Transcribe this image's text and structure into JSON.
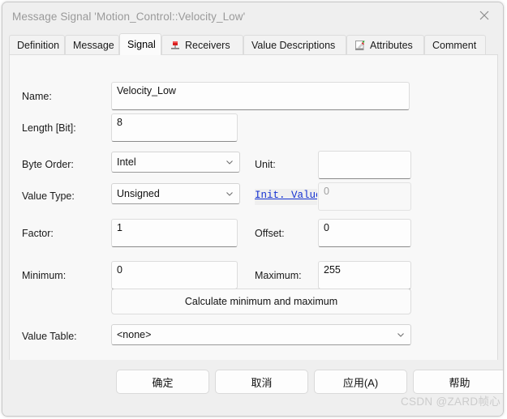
{
  "window": {
    "title": "Message Signal 'Motion_Control::Velocity_Low'",
    "close_icon": "close-icon"
  },
  "tabs": [
    {
      "label": "Definition",
      "icon": "",
      "selected": false
    },
    {
      "label": "Message",
      "icon": "",
      "selected": false
    },
    {
      "label": "Signal",
      "icon": "",
      "selected": true
    },
    {
      "label": "Receivers",
      "icon": "node-icon",
      "selected": false
    },
    {
      "label": "Value Descriptions",
      "icon": "",
      "selected": false
    },
    {
      "label": "Attributes",
      "icon": "pencil-icon",
      "selected": false
    },
    {
      "label": "Comment",
      "icon": "",
      "selected": false
    }
  ],
  "form": {
    "name_label": "Name:",
    "name_value": "Velocity_Low",
    "length_label": "Length [Bit]:",
    "length_value": "8",
    "byte_order_label": "Byte Order:",
    "byte_order_value": "Intel",
    "unit_label": "Unit:",
    "unit_value": "",
    "value_type_label": "Value Type:",
    "value_type_value": "Unsigned",
    "init_value_label": "Init. Value:",
    "init_value_value": "0",
    "factor_label": "Factor:",
    "factor_value": "1",
    "offset_label": "Offset:",
    "offset_value": "0",
    "minimum_label": "Minimum:",
    "minimum_value": "0",
    "maximum_label": "Maximum:",
    "maximum_value": "255",
    "calculate_button": "Calculate minimum and maximum",
    "value_table_label": "Value Table:",
    "value_table_value": "<none>"
  },
  "footer": {
    "ok": "确定",
    "cancel": "取消",
    "apply": "应用(A)",
    "help": "帮助"
  },
  "watermark": "CSDN @ZARD帧心",
  "colors": {
    "link": "#1431d2",
    "title_text": "#9a9a9a",
    "panel_bg": "#f8f8f8",
    "dialog_bg": "#efefef"
  }
}
